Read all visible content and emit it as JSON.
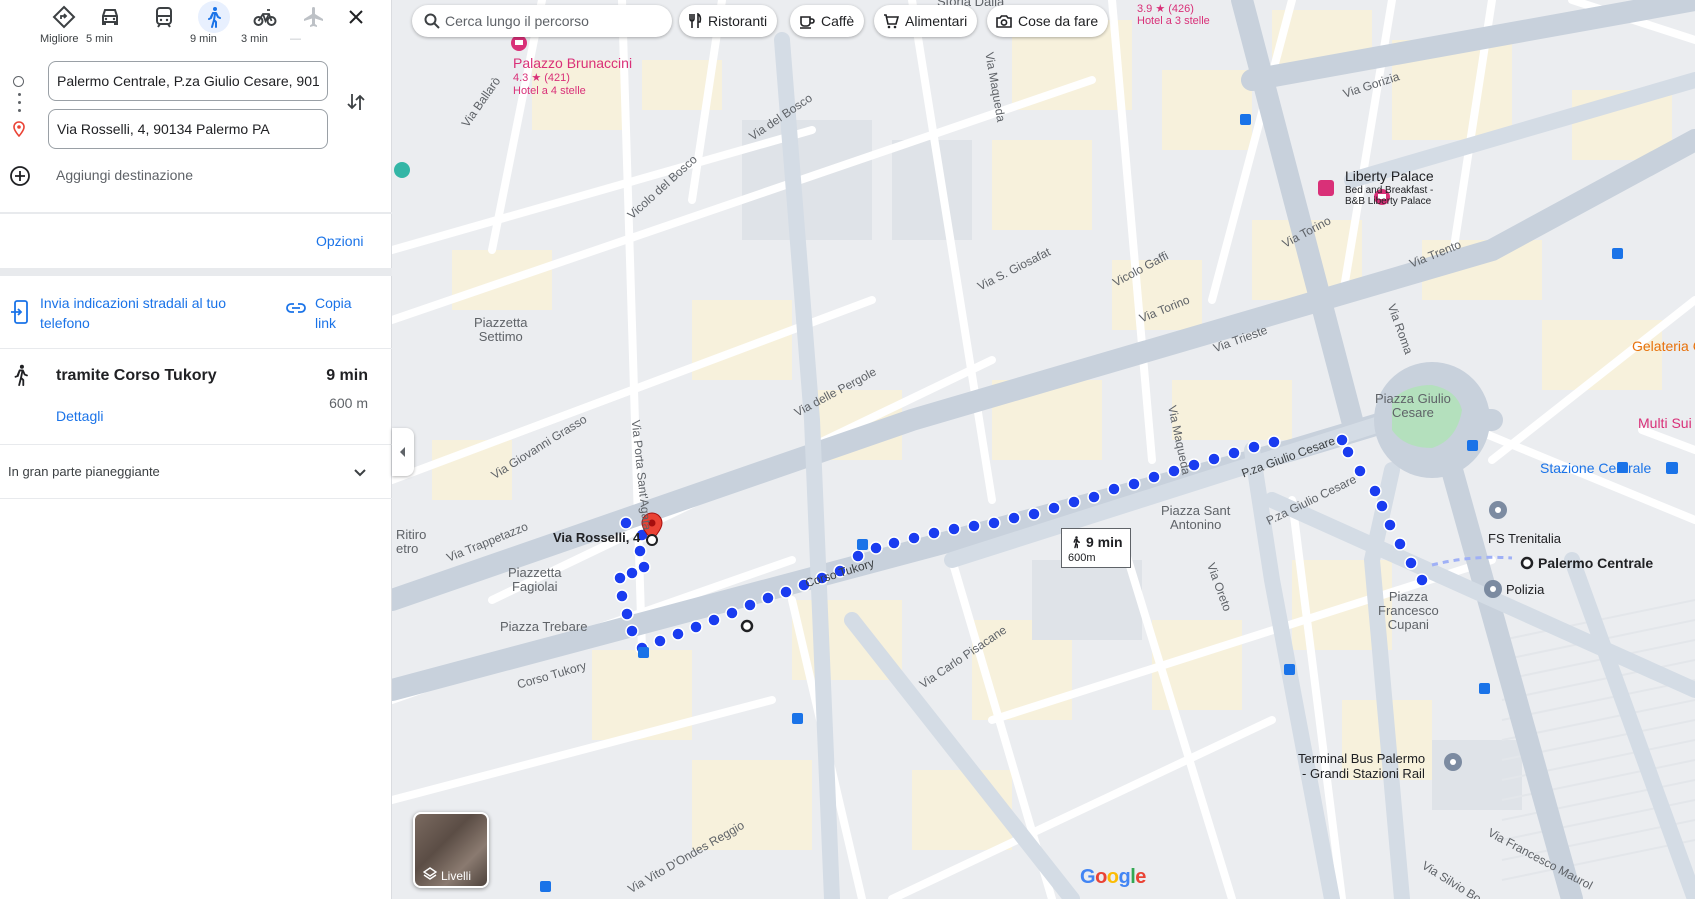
{
  "travel_modes": [
    {
      "id": "best",
      "label": "Migliore",
      "icon": "best-route-icon"
    },
    {
      "id": "car",
      "label": "5 min",
      "icon": "car-icon"
    },
    {
      "id": "transit",
      "label": "",
      "icon": "transit-icon"
    },
    {
      "id": "walk",
      "label": "9 min",
      "icon": "walk-icon",
      "active": true
    },
    {
      "id": "bike",
      "label": "3 min",
      "icon": "bike-icon"
    },
    {
      "id": "flight",
      "label": "—",
      "icon": "flight-icon",
      "disabled": true
    }
  ],
  "directions": {
    "origin_value": "Palermo Centrale, P.za Giulio Cesare, 901",
    "destination_value": "Via Rosselli, 4, 90134 Palermo PA",
    "add_destination": "Aggiungi destinazione",
    "options_link": "Opzioni",
    "send_to_phone": "Invia indicazioni stradali al tuo telefono",
    "copy_link": "Copia link"
  },
  "route": {
    "name": "tramite Corso Tukory",
    "duration": "9 min",
    "distance": "600 m",
    "details_link": "Dettagli",
    "terrain": "In gran parte pianeggiante"
  },
  "map": {
    "search_placeholder": "Cerca lungo il percorso",
    "chips": [
      "Ristoranti",
      "Caffè",
      "Alimentari",
      "Cose da fare"
    ],
    "callout": {
      "duration": "9 min",
      "distance": "600m"
    },
    "layers_label": "Livelli",
    "attribution": "Google",
    "route_color": "#1a3cf0",
    "labels": {
      "palazzo": "Palazzo Brunaccini",
      "palazzo_rating": "4.3 ★ (421)",
      "palazzo_type": "Hotel a 4 stelle",
      "storia": "Storia Dalla",
      "top_rating": "3.9 ★ (426)",
      "top_type": "Hotel a 3 stelle",
      "liberty": "Liberty Palace",
      "liberty_sub1": "Bed and Breakfast -",
      "liberty_sub2": "B&B Liberty Palace",
      "gelateria": "Gelateria C",
      "multi": "Multi Sui",
      "stazione": "Stazione Centrale",
      "trenitalia": "FS Trenitalia",
      "polizia": "Polizia",
      "palermo_centrale": "Palermo Centrale",
      "via_rosselli": "Via Rosselli, 4",
      "terminal1": "Terminal Bus Palermo",
      "terminal2": "- Grandi Stazioni Rail",
      "piazza_giulio1": "Piazza Giulio",
      "piazza_giulio2": "Cesare",
      "piazza_sant1": "Piazza Sant",
      "piazza_sant2": "Antonino",
      "piazza_cupani1": "Piazza",
      "piazza_cupani2": "Francesco",
      "piazza_cupani3": "Cupani",
      "settimo1": "Piazzetta",
      "settimo2": "Settimo",
      "fagiolai1": "Piazzetta",
      "fagiolai2": "Fagiolai",
      "trebare": "Piazza Trebare",
      "ritiro1": "Ritiro",
      "ritiro2": "etro",
      "via_gorizia": "Via Gorizia",
      "via_torino": "Via Torino",
      "via_torino2": "Via Torino",
      "via_trento": "Via Trento",
      "via_trieste": "Via Trieste",
      "via_roma": "Via Roma",
      "vicolo_gaffi": "Vicolo Gaffi",
      "via_s_giosafat": "Via S. Giosafat",
      "via_pergole": "Via delle Pergole",
      "via_maqueda": "Via Maqueda",
      "via_maqueda2": "Via Maqueda",
      "via_bosco": "Via del Bosco",
      "vicolo_bosco": "Vicolo del Bosco",
      "via_balaro": "Via Ballarò",
      "via_grasso": "Via Giovanni Grasso",
      "via_trappetazzo": "Via Trappetazzo",
      "via_porta": "Via Porta Sant'Agata",
      "corso_tukory": "Corso Tukory",
      "corso_tukory2": "Corso Tukory",
      "pza_giulio": "P.za Giulio Cesare",
      "pza_giulio2": "P.za Giulio Cesare",
      "via_oreto": "Via Oreto",
      "via_carlo": "Via Carlo Pisacane",
      "via_vito": "Via Vito D'Ondes Reggio",
      "via_silvio": "Via Silvio Bo",
      "via_francesco": "Via Francesco Maurol"
    }
  }
}
